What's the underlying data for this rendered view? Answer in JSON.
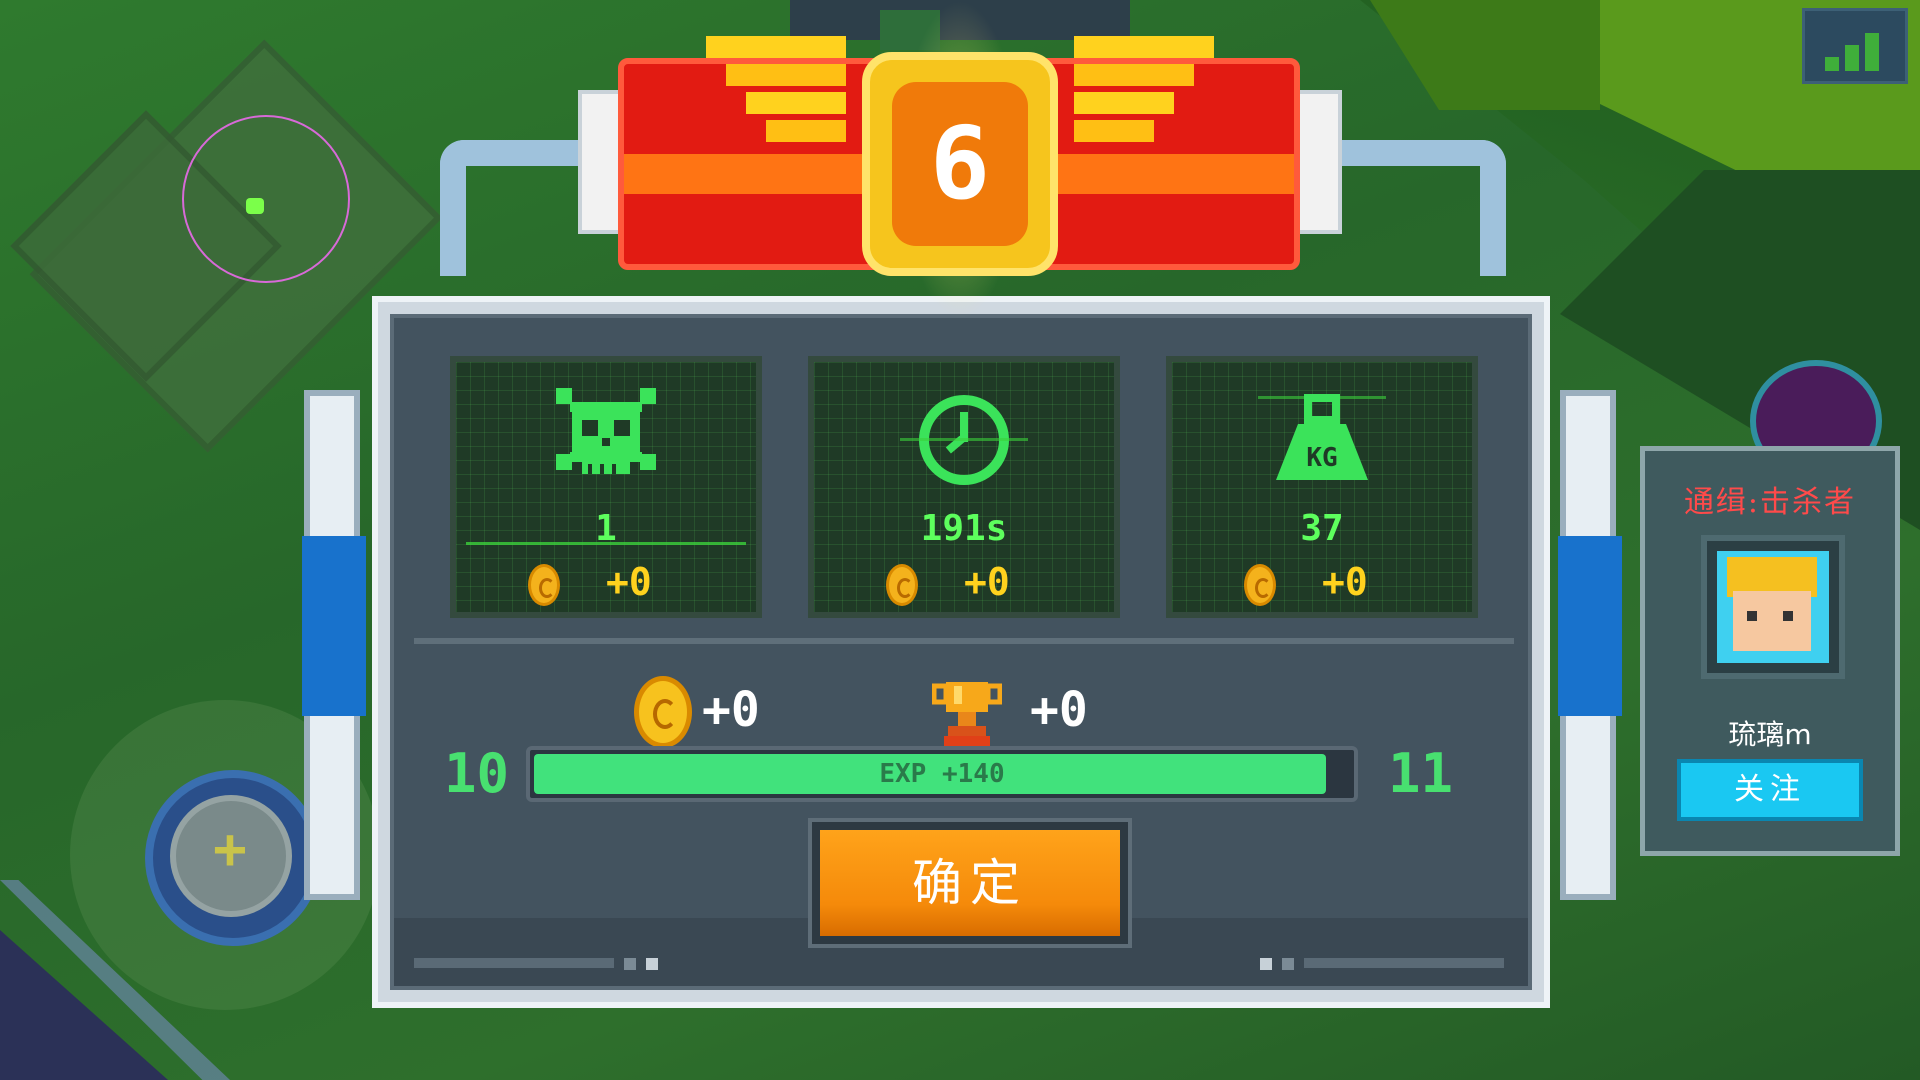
{
  "rank": {
    "value": "6"
  },
  "stats": [
    {
      "icon": "skull-icon",
      "value": "1",
      "reward": "+0"
    },
    {
      "icon": "clock-icon",
      "value": "191s",
      "reward": "+0"
    },
    {
      "icon": "weight-icon",
      "weight_label": "KG",
      "value": "37",
      "reward": "+0"
    }
  ],
  "totals": {
    "coins": "+0",
    "trophies": "+0"
  },
  "experience": {
    "level_current": "10",
    "level_next": "11",
    "label": "EXP +140",
    "progress": 0.97
  },
  "confirm": {
    "label": "确定"
  },
  "wanted": {
    "title": "通缉:击杀者",
    "player_name": "琉璃m",
    "follow_label": "关注"
  },
  "colors": {
    "accent_green": "#41e27c",
    "coin_gold": "#f7c21e",
    "wanted_red": "#ff4a4a",
    "follow_cyan": "#1ac8f2"
  }
}
